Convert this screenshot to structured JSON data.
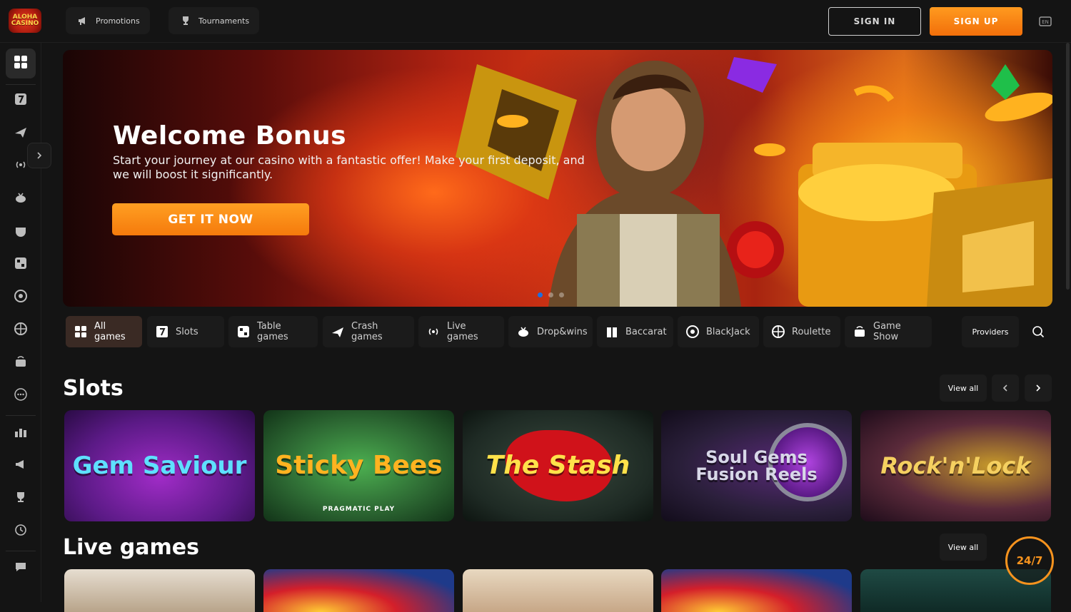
{
  "header": {
    "logo_text": "ALOHA CASINO",
    "tabs": [
      {
        "label": "Promotions",
        "icon": "megaphone-icon"
      },
      {
        "label": "Tournaments",
        "icon": "trophy-icon"
      }
    ],
    "signin_label": "SIGN IN",
    "signup_label": "SIGN UP",
    "language_icon": "language-icon"
  },
  "sidebar": {
    "items": [
      {
        "icon": "grid-icon",
        "active": true
      },
      {
        "icon": "slot-seven-icon"
      },
      {
        "icon": "plane-icon"
      },
      {
        "icon": "live-signal-icon"
      },
      {
        "icon": "dropwins-icon"
      },
      {
        "icon": "baccarat-icon"
      },
      {
        "icon": "table-games-icon"
      },
      {
        "icon": "roulette-icon"
      },
      {
        "icon": "roulette-alt-icon"
      },
      {
        "icon": "game-show-icon"
      },
      {
        "icon": "more-icon"
      },
      {
        "icon": "leaderboard-icon"
      },
      {
        "icon": "megaphone-icon"
      },
      {
        "icon": "trophy-icon"
      },
      {
        "icon": "history-icon"
      },
      {
        "icon": "chat-icon"
      }
    ]
  },
  "hero": {
    "title": "Welcome Bonus",
    "subtitle": "Start your journey at our casino with a fantastic offer! Make your first deposit, and we will boost it significantly.",
    "cta": "GET IT NOW",
    "slides": 3,
    "active_slide": 0
  },
  "categories": [
    {
      "label": "All games",
      "icon": "grid-icon",
      "active": true
    },
    {
      "label": "Slots",
      "icon": "slot-seven-icon"
    },
    {
      "label": "Table games",
      "icon": "table-games-icon"
    },
    {
      "label": "Crash games",
      "icon": "plane-icon"
    },
    {
      "label": "Live games",
      "icon": "live-signal-icon"
    },
    {
      "label": "Drop&wins",
      "icon": "dropwins-icon"
    },
    {
      "label": "Baccarat",
      "icon": "baccarat-icon"
    },
    {
      "label": "BlackJack",
      "icon": "blackjack-icon"
    },
    {
      "label": "Roulette",
      "icon": "roulette-icon"
    },
    {
      "label": "Game Show",
      "icon": "game-show-icon"
    }
  ],
  "providers_label": "Providers",
  "slots": {
    "title": "Slots",
    "view_all": "View all",
    "games": [
      {
        "name": "Gem Saviour",
        "bg": "#6a1b9a"
      },
      {
        "name": "Sticky Bees",
        "provider": "PRAGMATIC PLAY",
        "bg": "#2e7d32"
      },
      {
        "name": "The Stash",
        "bg": "#1e2a24"
      },
      {
        "name": "Soul Gems Fusion Reels",
        "bg": "#2a1f3a"
      },
      {
        "name": "Rock'n'Lock",
        "bg": "#3a1a3a"
      }
    ]
  },
  "live": {
    "title": "Live games",
    "view_all": "View all"
  },
  "support_badge": "24/7"
}
